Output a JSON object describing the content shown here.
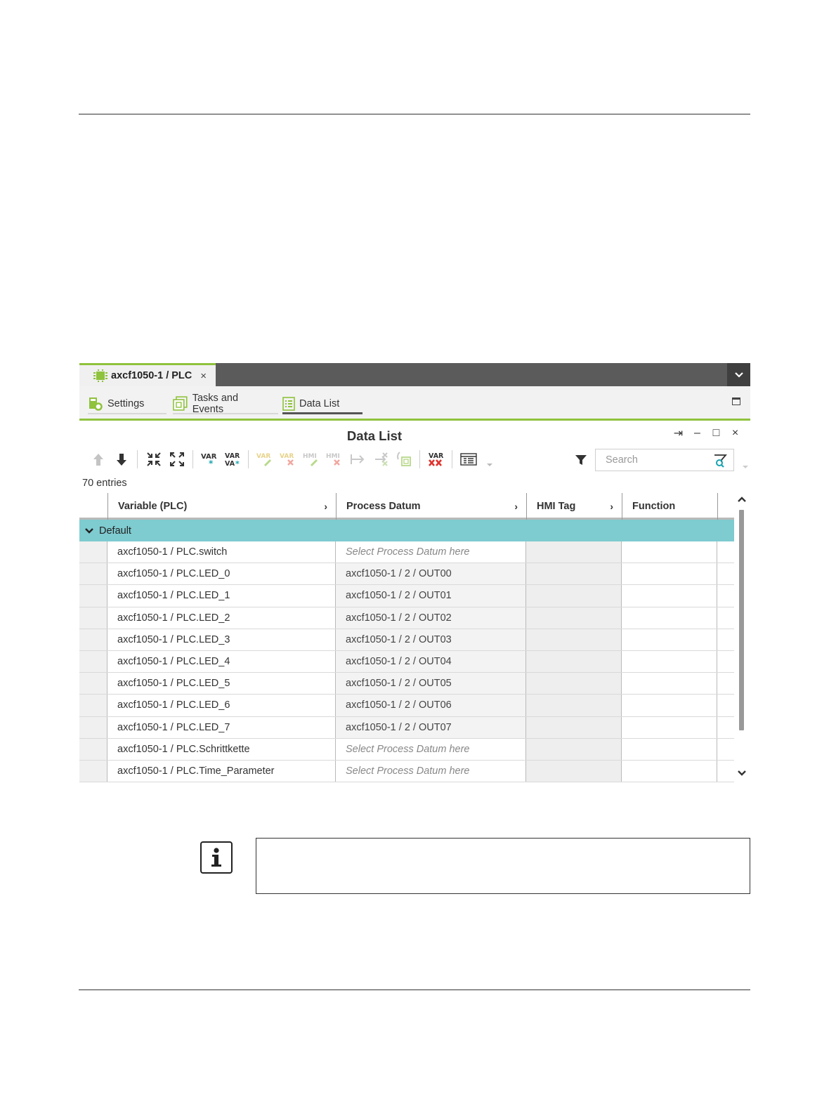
{
  "document_tab": {
    "label": "axcf1050-1 / PLC",
    "close": "×"
  },
  "editor_tabs": [
    {
      "label": "Settings",
      "active": false
    },
    {
      "label": "Tasks and Events",
      "active": false
    },
    {
      "label": "Data List",
      "active": true
    }
  ],
  "panel": {
    "title": "Data List",
    "controls": {
      "pin": "⇥",
      "minimize": "–",
      "maximize": "□",
      "close": "×"
    },
    "search_placeholder": "Search",
    "entries_count": "70 entries"
  },
  "toolbar": {
    "icons": [
      "move-up-icon",
      "move-down-icon",
      "collapse-all-icon",
      "expand-all-icon",
      "add-variable-icon",
      "add-variable-group-icon",
      "edit-variable-icon",
      "delete-variable-icon",
      "edit-hmi-tag-icon",
      "delete-hmi-tag-icon",
      "connect-icon",
      "disconnect-icon",
      "copy-icon",
      "delete-all-variables-icon",
      "column-settings-icon",
      "filter-icon"
    ],
    "accent_red": "#e0322d",
    "accent_teal": "#1aa3b0"
  },
  "grid": {
    "columns": [
      {
        "label": "Variable (PLC)",
        "has_arrow": true
      },
      {
        "label": "Process Datum",
        "has_arrow": true
      },
      {
        "label": "HMI Tag",
        "has_arrow": true
      },
      {
        "label": "Function",
        "has_arrow": false
      }
    ],
    "group": {
      "label": "Default",
      "color": "#7ecbd0"
    },
    "rows": [
      {
        "variable": "axcf1050-1 / PLC.switch",
        "datum": "Select Process Datum here",
        "placeholder": true
      },
      {
        "variable": "axcf1050-1 / PLC.LED_0",
        "datum": "axcf1050-1 / 2 / OUT00",
        "placeholder": false
      },
      {
        "variable": "axcf1050-1 / PLC.LED_1",
        "datum": "axcf1050-1 / 2 / OUT01",
        "placeholder": false
      },
      {
        "variable": "axcf1050-1 / PLC.LED_2",
        "datum": "axcf1050-1 / 2 / OUT02",
        "placeholder": false
      },
      {
        "variable": "axcf1050-1 / PLC.LED_3",
        "datum": "axcf1050-1 / 2 / OUT03",
        "placeholder": false
      },
      {
        "variable": "axcf1050-1 / PLC.LED_4",
        "datum": "axcf1050-1 / 2 / OUT04",
        "placeholder": false
      },
      {
        "variable": "axcf1050-1 / PLC.LED_5",
        "datum": "axcf1050-1 / 2 / OUT05",
        "placeholder": false
      },
      {
        "variable": "axcf1050-1 / PLC.LED_6",
        "datum": "axcf1050-1 / 2 / OUT06",
        "placeholder": false
      },
      {
        "variable": "axcf1050-1 / PLC.LED_7",
        "datum": "axcf1050-1 / 2 / OUT07",
        "placeholder": false
      },
      {
        "variable": "axcf1050-1 / PLC.Schrittkette",
        "datum": "Select Process Datum here",
        "placeholder": true
      },
      {
        "variable": "axcf1050-1 / PLC.Time_Parameter",
        "datum": "Select Process Datum here",
        "placeholder": true
      }
    ]
  },
  "colors": {
    "accent_green": "#8fc23d",
    "tabbar_dark": "#5b5b5b"
  }
}
